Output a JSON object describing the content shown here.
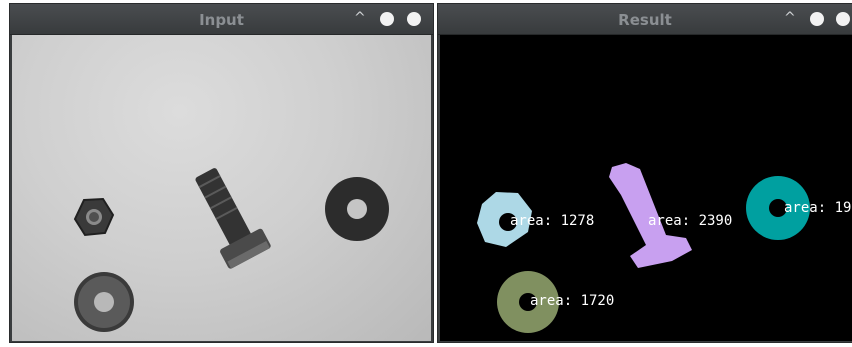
{
  "windows": {
    "input": {
      "title": "Input"
    },
    "result": {
      "title": "Result"
    }
  },
  "controls": {
    "collapse_glyph": "^"
  },
  "result_labels": [
    {
      "text": "area: 1278",
      "color": "#add8e6"
    },
    {
      "text": "area: 2390",
      "color": "#c8a0f0"
    },
    {
      "text": "area: 19",
      "color": "#00a0a0"
    },
    {
      "text": "area: 1720",
      "color": "#809060"
    }
  ],
  "colors": {
    "titlebar": "#3d4042",
    "title_text": "#8b8f93",
    "result_background": "#000000",
    "label_text": "#ffffff"
  }
}
